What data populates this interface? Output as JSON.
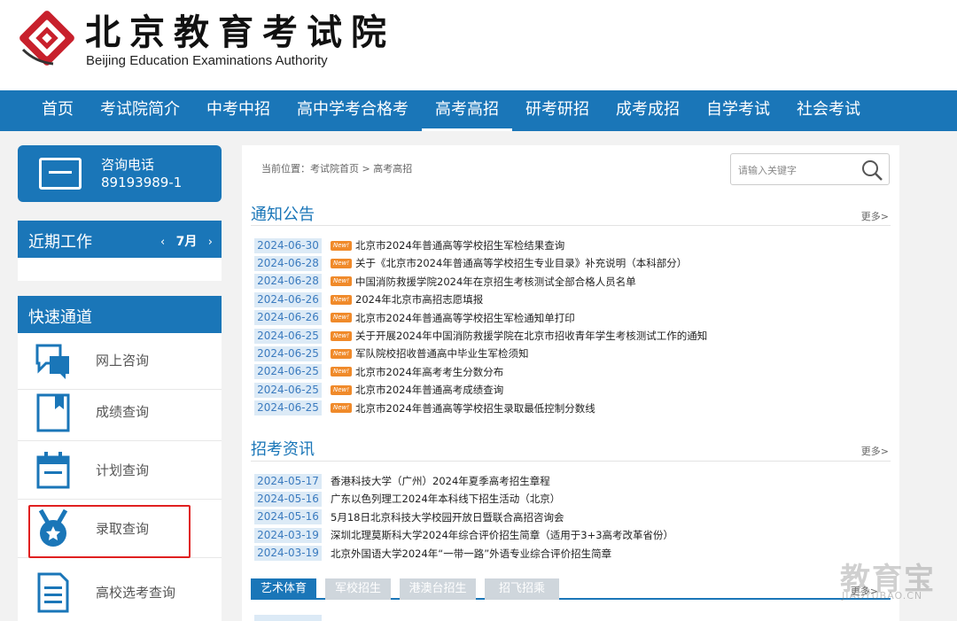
{
  "colors": {
    "brand": "#1a76b8",
    "new_badge": "#f08a2a",
    "date_bg": "#dceaf6",
    "highlight": "#e02020"
  },
  "header": {
    "name_cn": "北京教育考试院",
    "name_en": "Beijing Education Examinations Authority"
  },
  "nav": {
    "items": [
      {
        "label": "首页"
      },
      {
        "label": "考试院简介"
      },
      {
        "label": "中考中招"
      },
      {
        "label": "高中学考合格考"
      },
      {
        "label": "高考高招"
      },
      {
        "label": "研考研招"
      },
      {
        "label": "成考成招"
      },
      {
        "label": "自学考试"
      },
      {
        "label": "社会考试"
      }
    ],
    "active_index": 4
  },
  "sidebar": {
    "phone": {
      "label": "咨询电话",
      "number": "89193989-1"
    },
    "recent": {
      "title": "近期工作",
      "prev": "‹",
      "month": "7月",
      "next": "›"
    },
    "quick": {
      "title": "快速通道",
      "items": [
        {
          "label": "网上咨询",
          "icon": "chat-icon"
        },
        {
          "label": "成绩查询",
          "icon": "bookmark-icon"
        },
        {
          "label": "计划查询",
          "icon": "calendar-icon"
        },
        {
          "label": "录取查询",
          "icon": "medal-icon"
        },
        {
          "label": "高校选考查询",
          "icon": "document-icon"
        }
      ]
    }
  },
  "main": {
    "breadcrumb": "当前位置：考试院首页 > 高考高招",
    "search": {
      "placeholder": "请输入关键字"
    },
    "notices": {
      "title": "通知公告",
      "more": "更多>",
      "badge": "New!",
      "items": [
        {
          "date": "2024-06-30",
          "title": "北京市2024年普通高等学校招生军检结果查询"
        },
        {
          "date": "2024-06-28",
          "title": "关于《北京市2024年普通高等学校招生专业目录》补充说明（本科部分）"
        },
        {
          "date": "2024-06-28",
          "title": "中国消防救援学院2024年在京招生考核测试全部合格人员名单"
        },
        {
          "date": "2024-06-26",
          "title": "2024年北京市高招志愿填报"
        },
        {
          "date": "2024-06-26",
          "title": "北京市2024年普通高等学校招生军检通知单打印"
        },
        {
          "date": "2024-06-25",
          "title": "关于开展2024年中国消防救援学院在北京市招收青年学生考核测试工作的通知"
        },
        {
          "date": "2024-06-25",
          "title": "军队院校招收普通高中毕业生军检须知"
        },
        {
          "date": "2024-06-25",
          "title": "北京市2024年高考考生分数分布"
        },
        {
          "date": "2024-06-25",
          "title": "北京市2024年普通高考成绩查询"
        },
        {
          "date": "2024-06-25",
          "title": "北京市2024年普通高等学校招生录取最低控制分数线"
        }
      ]
    },
    "info": {
      "title": "招考资讯",
      "more": "更多>",
      "items": [
        {
          "date": "2024-05-17",
          "title": "香港科技大学（广州）2024年夏季高考招生章程"
        },
        {
          "date": "2024-05-16",
          "title": "广东以色列理工2024年本科线下招生活动（北京）"
        },
        {
          "date": "2024-05-16",
          "title": "5月18日北京科技大学校园开放日暨联合高招咨询会"
        },
        {
          "date": "2024-03-19",
          "title": "深圳北理莫斯科大学2024年综合评价招生简章（适用于3+3高考改革省份）"
        },
        {
          "date": "2024-03-19",
          "title": "北京外国语大学2024年“一带一路”外语专业综合评价招生简章"
        }
      ]
    },
    "tabs": {
      "items": [
        {
          "label": "艺术体育"
        },
        {
          "label": "军校招生"
        },
        {
          "label": "港澳台招生"
        },
        {
          "label": "招飞招乘"
        }
      ],
      "active_index": 0,
      "more": "更多>"
    }
  },
  "watermark": {
    "cn": "教育宝",
    "en": "JIAOYUBAO.CN"
  }
}
